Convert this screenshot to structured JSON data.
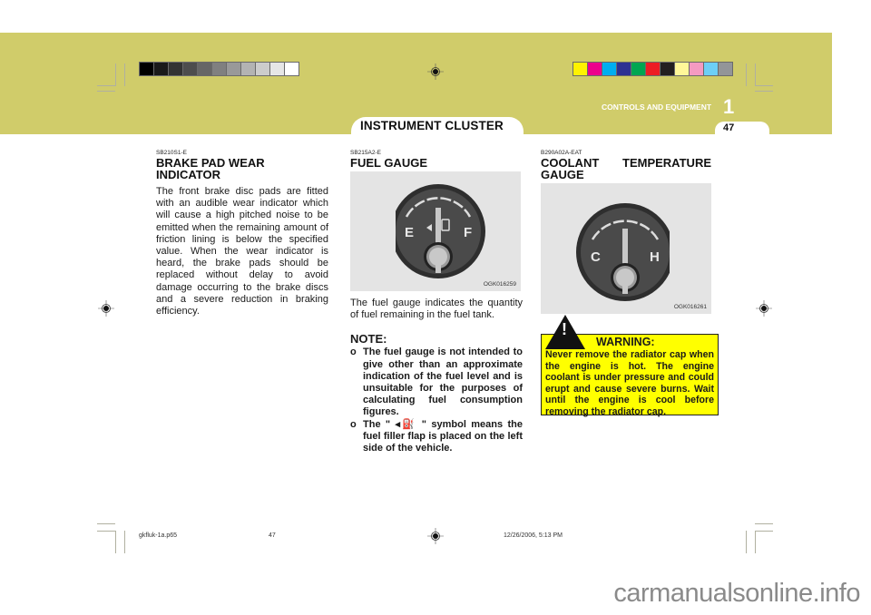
{
  "header": {
    "section_title": "CONTROLS AND EQUIPMENT",
    "chapter_number": "1",
    "page_number": "47",
    "tab_title": "INSTRUMENT CLUSTER",
    "band_color": "#d0cc6a",
    "grayscale_swatches": [
      "#000000",
      "#1a1a1a",
      "#333333",
      "#4d4d4d",
      "#666666",
      "#808080",
      "#999999",
      "#b3b3b3",
      "#cccccc",
      "#e6e6e6",
      "#ffffff"
    ],
    "color_swatches": [
      "#fff200",
      "#ec008c",
      "#00aeef",
      "#2e3192",
      "#00a651",
      "#ed1c24",
      "#231f20",
      "#fff799",
      "#f49ac1",
      "#6dcff6",
      "#939598"
    ]
  },
  "brake_pad": {
    "code": "SB210S1-E",
    "title": "BRAKE PAD WEAR INDICATOR",
    "body": "The front brake disc pads are fitted with an audible wear indicator which will cause a high pitched noise to be emitted when the remaining amount of friction lining is below the specified value. When the wear indicator is heard, the brake pads should be replaced without delay to avoid damage occurring to the brake discs and a severe reduction in braking efficiency."
  },
  "fuel_gauge": {
    "code": "SB215A2-E",
    "title": "FUEL GAUGE",
    "image_code": "OGK016259",
    "label_empty": "E",
    "label_full": "F",
    "body": "The fuel gauge indicates the quantity of fuel remaining in the fuel tank.",
    "note_title": "NOTE:",
    "notes": [
      "The fuel gauge is not intended to give other than an approximate indication of the fuel level and is unsuitable for the purposes of calculating fuel consumption figures.",
      "The \" ◂⛽ \" symbol means the fuel filler flap is placed on the left side of the vehicle."
    ],
    "bullet": "o"
  },
  "coolant": {
    "code": "B290A02A-EAT",
    "title_line1": "COOLANT TEMPERATURE",
    "title_line2": "GAUGE",
    "image_code": "OGK016261",
    "label_cold": "C",
    "label_hot": "H",
    "warning_title": "WARNING:",
    "warning_body": "Never remove the radiator cap when the engine is hot. The engine coolant is under pressure and could erupt and cause severe burns. Wait until the engine is cool before removing the radiator cap.",
    "warning_color": "#ffff00"
  },
  "footer": {
    "file_name": "gkfluk-1a.p65",
    "page": "47",
    "timestamp": "12/26/2006, 5:13 PM",
    "watermark": "carmanualsonline.info"
  }
}
